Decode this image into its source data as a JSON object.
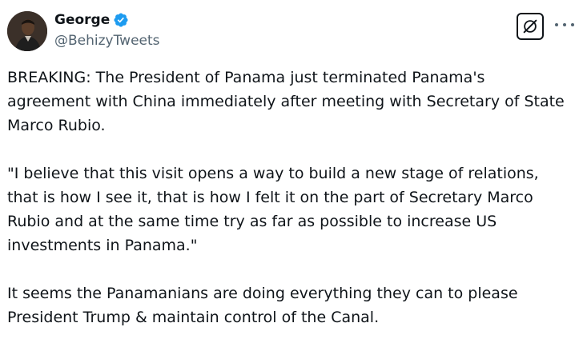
{
  "author": {
    "display_name": "George",
    "handle": "@BehizyTweets",
    "verified": true,
    "verified_color": "#1d9bf0"
  },
  "actions": {
    "grok_icon": "grok-icon",
    "more_icon": "more-options-icon"
  },
  "tweet": {
    "paragraphs": [
      "BREAKING: The President of Panama just terminated Panama's\nagreement with China immediately after meeting with Secretary of State\nMarco Rubio.",
      "\"I believe that this visit opens a way to build a new stage of relations,\nthat is how I see it, that is how I felt it on the part of Secretary Marco\nRubio and at the same time try as far as possible to increase US\ninvestments in Panama.\"",
      "It seems the Panamanians are doing everything they can to please\nPresident Trump & maintain control of the Canal."
    ]
  },
  "colors": {
    "text": "#0f1419",
    "secondary": "#536471"
  }
}
